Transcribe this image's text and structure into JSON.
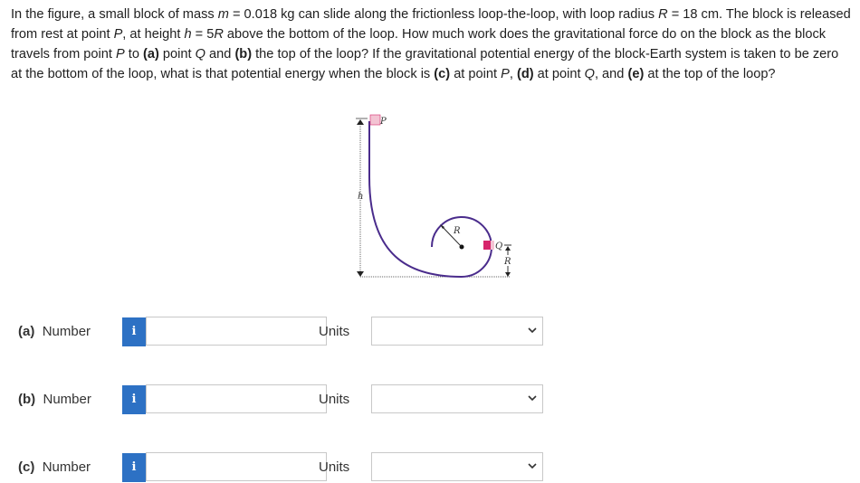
{
  "question": {
    "p1": "In the figure, a small block of mass ",
    "m_sym": "m",
    "p2": " = 0.018 kg can slide along the frictionless loop-the-loop, with loop radius ",
    "R_sym": "R",
    "p3": " = 18 cm. The block is released from rest at point ",
    "P_sym": "P",
    "p4": ", at height ",
    "h_sym": "h",
    "p5": " = 5",
    "R_sym2": "R",
    "p6": " above the bottom of the loop. How much work does the gravitational force do on the block as the block travels from point ",
    "P_sym2": "P",
    "p7": " to ",
    "a_tag": "(a)",
    "p8": " point ",
    "Q_sym": "Q",
    "p9": " and ",
    "b_tag": "(b)",
    "p10": " the top of the loop? If the gravitational potential energy of the block-Earth system is taken to be zero at the bottom of the loop, what is that potential energy when the block is ",
    "c_tag": "(c)",
    "p11": " at point ",
    "P_sym3": "P",
    "p12": ", ",
    "d_tag": "(d)",
    "p13": " at point ",
    "Q_sym2": "Q",
    "p14": ", and ",
    "e_tag": "(e)",
    "p15": " at the top of the loop?"
  },
  "figure": {
    "label_P": "P",
    "label_h": "h",
    "label_R_loop": "R",
    "label_Q": "Q",
    "label_R_side": "R",
    "track_color": "#4a2c8c",
    "block_color": "#d6256b"
  },
  "answers": [
    {
      "tag": "(a)",
      "label": "Number",
      "info": "i",
      "value": "",
      "units_label": "Units",
      "units_value": ""
    },
    {
      "tag": "(b)",
      "label": "Number",
      "info": "i",
      "value": "",
      "units_label": "Units",
      "units_value": ""
    },
    {
      "tag": "(c)",
      "label": "Number",
      "info": "i",
      "value": "",
      "units_label": "Units",
      "units_value": ""
    }
  ]
}
